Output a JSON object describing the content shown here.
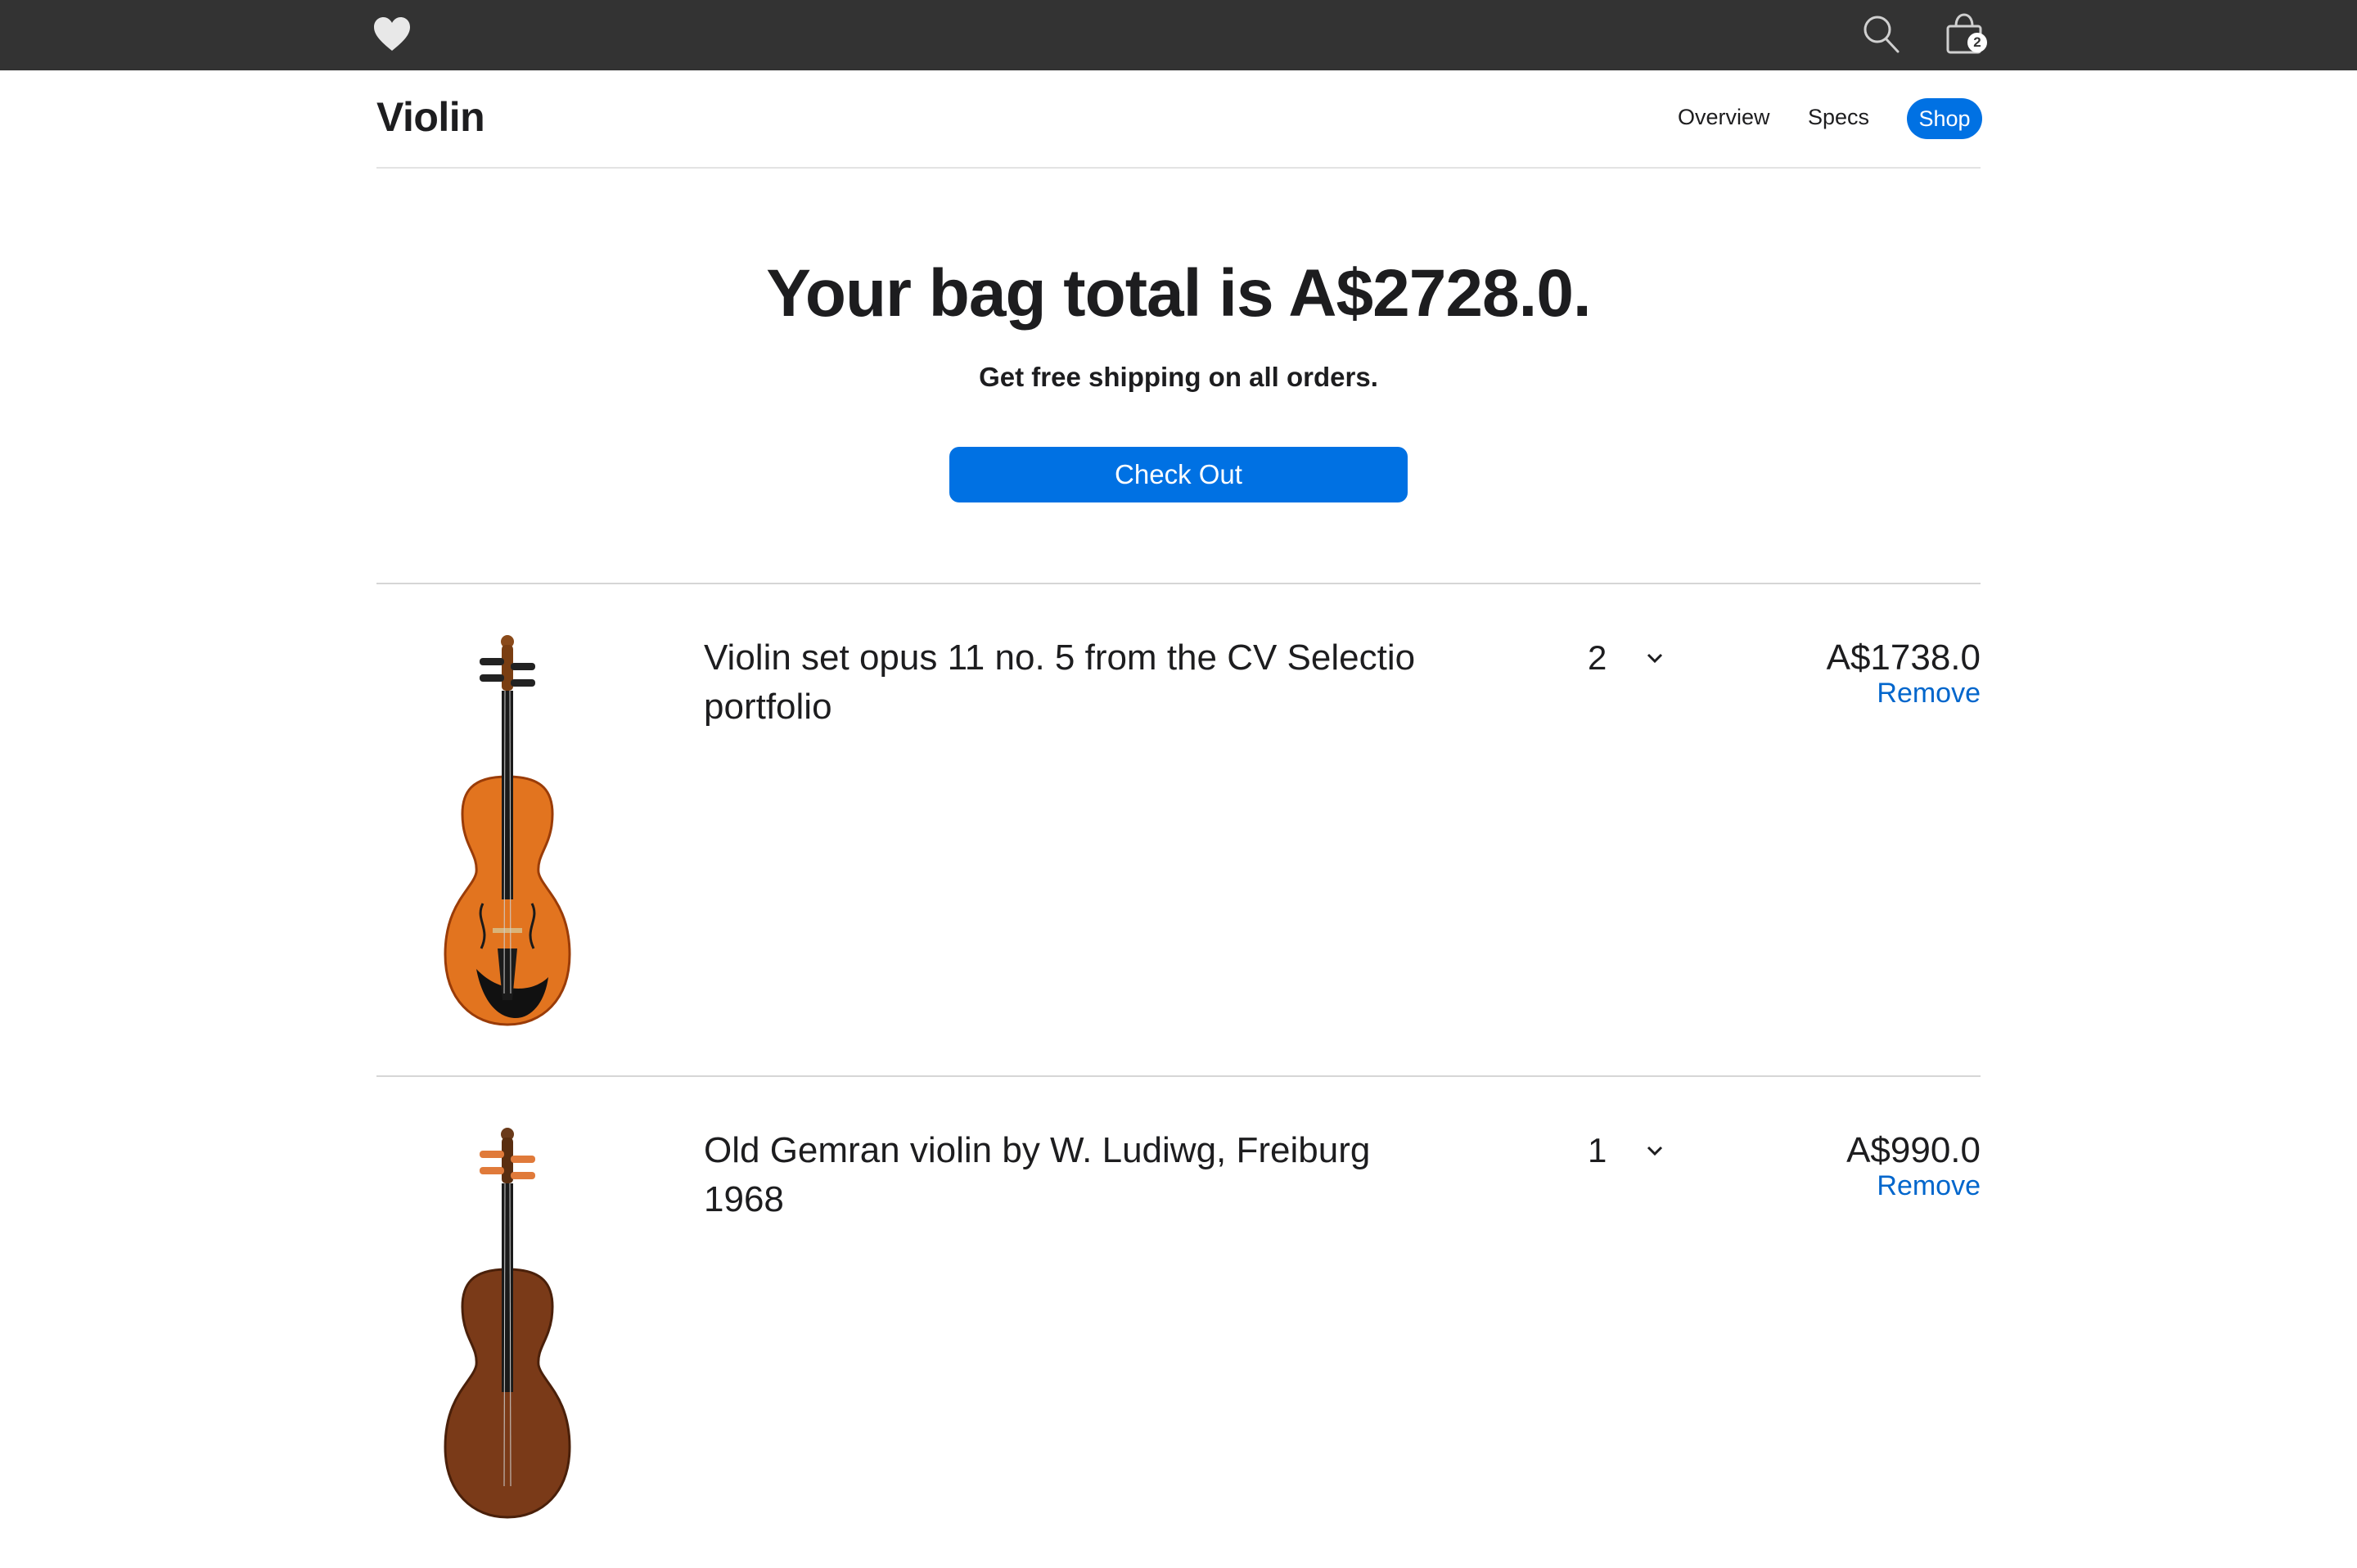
{
  "header": {
    "logo_icon": "heart-icon",
    "search_icon": "search-icon",
    "bag_icon": "shopping-bag-icon",
    "bag_count": "2"
  },
  "subnav": {
    "title": "Violin",
    "links": [
      "Overview",
      "Specs",
      "Shop"
    ],
    "active": "Shop"
  },
  "summary": {
    "headline": "Your bag total is A$2728.0.",
    "subline": "Get free shipping on all orders.",
    "checkout_label": "Check Out"
  },
  "items": [
    {
      "name": "Violin set opus 11 no. 5 from the CV Selectio portfolio",
      "quantity": "2",
      "price": "A$1738.0",
      "remove_label": "Remove"
    },
    {
      "name": "Old Gemran violin by W. Ludiwg, Freiburg 1968",
      "quantity": "1",
      "price": "A$990.0",
      "remove_label": "Remove"
    }
  ],
  "colors": {
    "topbar": "#333333",
    "accent": "#0071e3",
    "link": "#0066cc"
  }
}
